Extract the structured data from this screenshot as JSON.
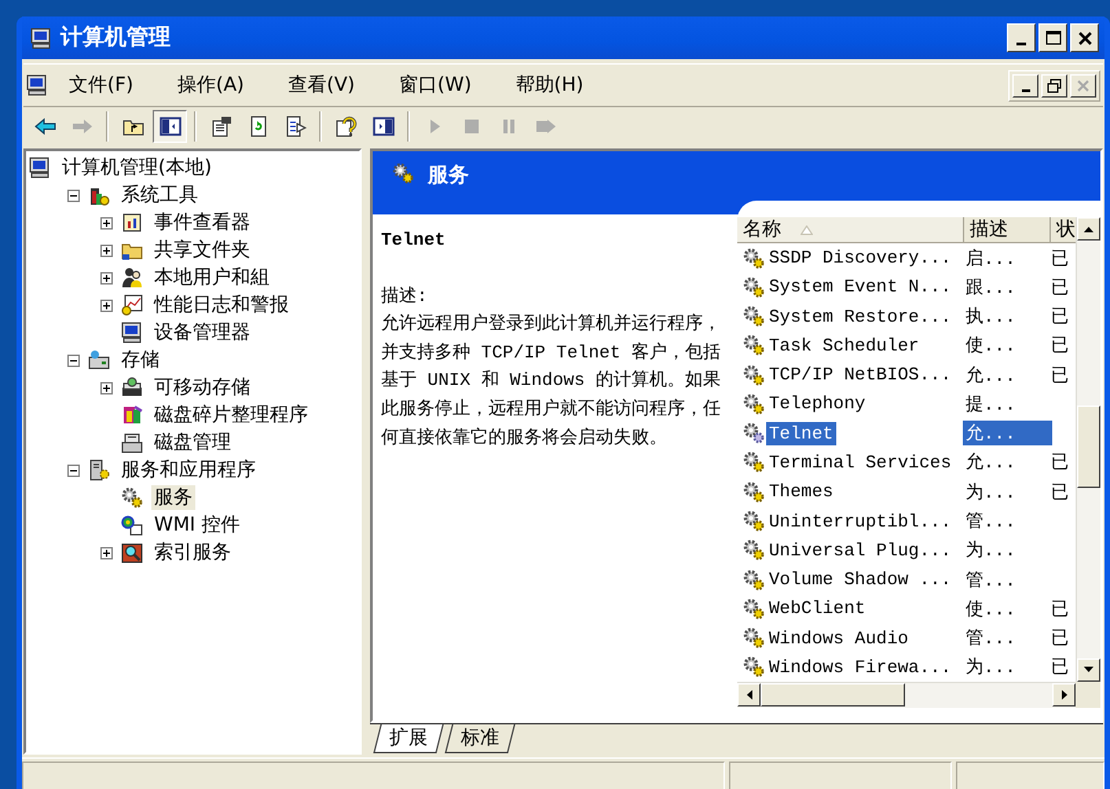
{
  "window": {
    "title": "计算机管理"
  },
  "menu": [
    "文件(F)",
    "操作(A)",
    "查看(V)",
    "窗口(W)",
    "帮助(H)"
  ],
  "mdi_buttons": [
    {
      "disabled": false
    },
    {
      "disabled": false
    },
    {
      "disabled": true
    }
  ],
  "toolbar": [
    [
      {
        "disabled": false,
        "pressed": false
      },
      {
        "disabled": true,
        "pressed": false
      }
    ],
    [
      {
        "disabled": false,
        "pressed": false
      },
      {
        "disabled": false,
        "pressed": true
      }
    ],
    [
      {
        "disabled": false,
        "pressed": false
      },
      {
        "disabled": false,
        "pressed": false
      },
      {
        "disabled": false,
        "pressed": false
      }
    ],
    [
      {
        "disabled": false,
        "pressed": false
      },
      {
        "disabled": false,
        "pressed": false
      }
    ],
    [
      {
        "disabled": true,
        "pressed": false
      },
      {
        "disabled": true,
        "pressed": false
      },
      {
        "disabled": true,
        "pressed": false
      },
      {
        "disabled": true,
        "pressed": false
      }
    ]
  ],
  "tree": [
    {
      "label": "计算机管理(本地)",
      "selected": false,
      "children": [
        {
          "label": "系统工具",
          "expanded": true,
          "selected": false,
          "children": [
            {
              "label": "事件查看器",
              "expanded": false,
              "selected": false
            },
            {
              "label": "共享文件夹",
              "expanded": false,
              "selected": false
            },
            {
              "label": "本地用户和組",
              "expanded": false,
              "selected": false
            },
            {
              "label": "性能日志和警报",
              "expanded": false,
              "selected": false
            },
            {
              "label": "设备管理器",
              "selected": false
            }
          ]
        },
        {
          "label": "存储",
          "expanded": true,
          "selected": false,
          "children": [
            {
              "label": "可移动存储",
              "expanded": false,
              "selected": false
            },
            {
              "label": "磁盘碎片整理程序",
              "selected": false
            },
            {
              "label": "磁盘管理",
              "selected": false
            }
          ]
        },
        {
          "label": "服务和应用程序",
          "expanded": true,
          "selected": false,
          "children": [
            {
              "label": "服务",
              "selected": true
            },
            {
              "label": "WMI 控件",
              "selected": false
            },
            {
              "label": "索引服务",
              "expanded": false,
              "selected": false
            }
          ]
        }
      ]
    }
  ],
  "pane": {
    "title": "服务",
    "description": {
      "heading": "Telnet",
      "label": "描述:",
      "text": "允许远程用户登录到此计算机并运行程序，并支持多种 TCP/IP Telnet 客户，包括基于 UNIX 和 Windows 的计算机。如果此服务停止，远程用户就不能访问程序，任何直接依靠它的服务将会启动失败。"
    },
    "columns": [
      {
        "label": "名称",
        "sorted": true
      },
      {
        "label": "描述",
        "sorted": false
      },
      {
        "label": "状",
        "sorted": false
      }
    ],
    "rows": [
      {
        "name": "SSDP Discovery...",
        "description": "启...",
        "status": "已",
        "selected": false
      },
      {
        "name": "System Event N...",
        "description": "跟...",
        "status": "已",
        "selected": false
      },
      {
        "name": "System Restore...",
        "description": "执...",
        "status": "已",
        "selected": false
      },
      {
        "name": "Task Scheduler",
        "description": "使...",
        "status": "已",
        "selected": false
      },
      {
        "name": "TCP/IP NetBIOS...",
        "description": "允...",
        "status": "已",
        "selected": false
      },
      {
        "name": "Telephony",
        "description": "提...",
        "selected": false
      },
      {
        "name": "Telnet",
        "description": "允...",
        "selected": true
      },
      {
        "name": "Terminal Services",
        "description": "允...",
        "status": "已",
        "selected": false
      },
      {
        "name": "Themes",
        "description": "为...",
        "status": "已",
        "selected": false
      },
      {
        "name": "Uninterruptibl...",
        "description": "管...",
        "selected": false
      },
      {
        "name": "Universal Plug...",
        "description": "为...",
        "selected": false
      },
      {
        "name": "Volume Shadow ...",
        "description": "管...",
        "selected": false
      },
      {
        "name": "WebClient",
        "description": "使...",
        "status": "已",
        "selected": false
      },
      {
        "name": "Windows Audio",
        "description": "管...",
        "status": "已",
        "selected": false
      },
      {
        "name": "Windows Firewa...",
        "description": "为...",
        "status": "已",
        "selected": false
      }
    ],
    "tabs": [
      {
        "label": "扩展",
        "selected": true
      },
      {
        "label": "标准",
        "selected": false
      }
    ]
  }
}
